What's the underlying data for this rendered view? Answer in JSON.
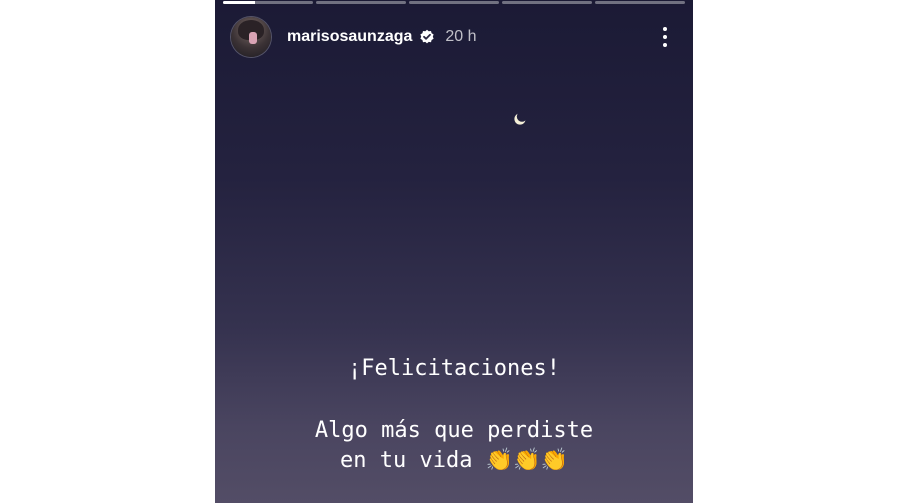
{
  "story": {
    "progress_segments": [
      {
        "state": "current",
        "fill": 0.35
      },
      {
        "state": "pending",
        "fill": 0
      },
      {
        "state": "pending",
        "fill": 0
      },
      {
        "state": "pending",
        "fill": 0
      },
      {
        "state": "pending",
        "fill": 0
      }
    ],
    "user": {
      "username": "marisosaunzaga",
      "verified": true,
      "time_ago": "20 h"
    },
    "icons": {
      "verified": "verified-badge-icon",
      "more": "more-options-icon",
      "moon": "crescent-moon"
    },
    "caption": {
      "heading": "¡Felicitaciones!",
      "body_line1": "Algo más que perdiste",
      "body_line2": "en tu vida",
      "emojis": "👏👏👏"
    }
  },
  "colors": {
    "sky_top": "#1b1a35",
    "sky_bottom": "#534d66",
    "text": "#ffffff"
  }
}
